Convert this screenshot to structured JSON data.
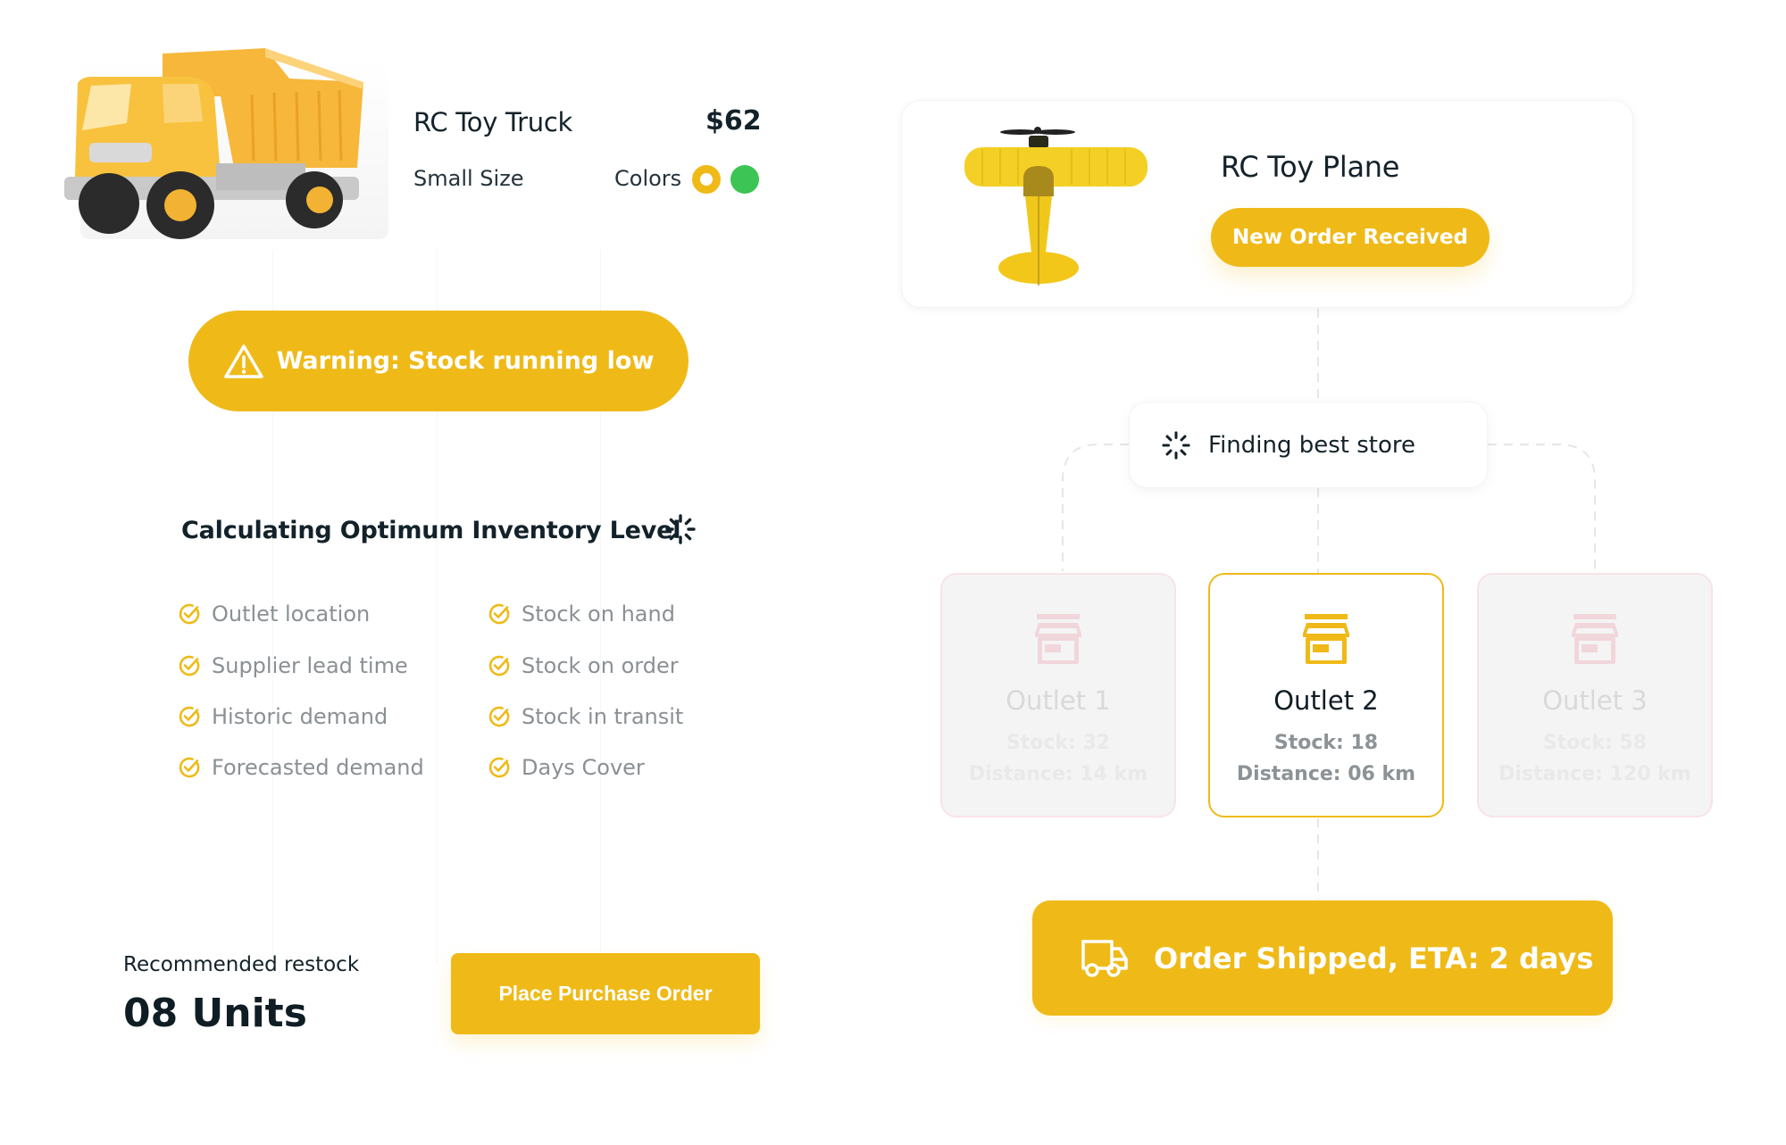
{
  "product": {
    "name": "RC Toy Truck",
    "price": "$62",
    "size": "Small Size",
    "colors_label": "Colors",
    "colors": [
      "#EFBA18",
      "#3CC454"
    ],
    "image": "toy-dump-truck"
  },
  "warning": {
    "icon": "warning-triangle-icon",
    "text": "Warning: Stock running low"
  },
  "calculation": {
    "title": "Calculating Optimum Inventory Level",
    "icon": "loading-spinner-icon",
    "factors": [
      "Outlet location",
      "Supplier lead time",
      "Historic demand",
      "Forecasted demand",
      "Stock on hand",
      "Stock on order",
      "Stock in transit",
      "Days Cover"
    ]
  },
  "restock": {
    "label": "Recommended restock",
    "value": "08 Units",
    "button_label": "Place Purchase Order"
  },
  "order": {
    "product_name": "RC Toy Plane",
    "image": "toy-biplane",
    "status_badge": "New Order Received"
  },
  "store_search": {
    "text": "Finding best store",
    "icon": "loading-spinner-icon"
  },
  "outlets": [
    {
      "name": "Outlet 1",
      "stock": "Stock: 32",
      "distance": "Distance: 14 km",
      "selected": false
    },
    {
      "name": "Outlet 2",
      "stock": "Stock: 18",
      "distance": "Distance: 06 km",
      "selected": true
    },
    {
      "name": "Outlet 3",
      "stock": "Stock: 58",
      "distance": "Distance: 120 km",
      "selected": false
    }
  ],
  "shipment": {
    "icon": "delivery-truck-icon",
    "text": "Order Shipped, ETA: 2 days"
  },
  "colors": {
    "accent": "#EFBA18",
    "text_dark": "#13222A",
    "text_muted": "#8A9094",
    "success_green": "#3CC454",
    "dim_border": "#F8E3E6",
    "dim_icon": "#F1D6DC"
  }
}
